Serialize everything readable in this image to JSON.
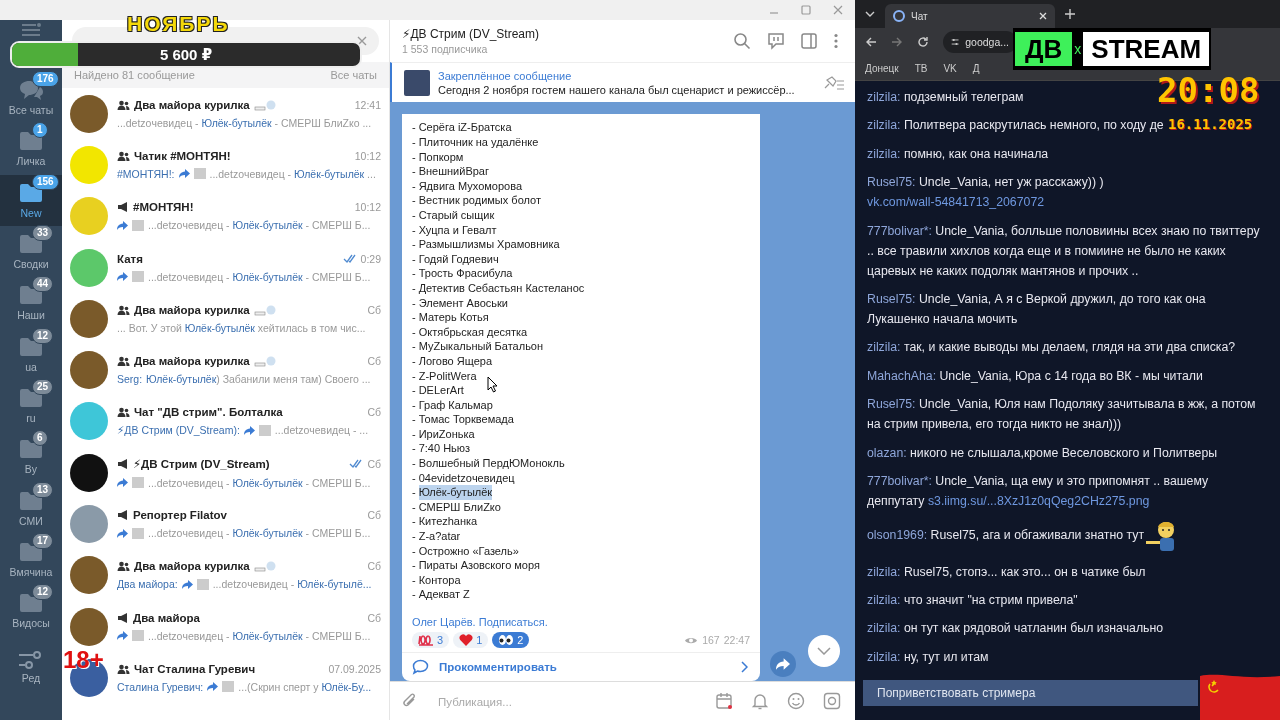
{
  "overlays": {
    "goal": {
      "title": "НОЯБРЬ",
      "amount": "5 600 ₽",
      "level": 0.19
    },
    "age_mark": "18+",
    "logo": {
      "left": "ДВ",
      "mid": "x",
      "right": "STREAM"
    },
    "clock": {
      "time": "20:08",
      "date": "16.11.2025"
    }
  },
  "folders": [
    {
      "kind": "all",
      "label": "Все чаты",
      "count": "176",
      "muted": false,
      "selected": false
    },
    {
      "kind": "folder",
      "label": "Личка",
      "count": "1",
      "muted": false,
      "selected": false
    },
    {
      "kind": "folder",
      "label": "New",
      "count": "156",
      "muted": false,
      "selected": true
    },
    {
      "kind": "folder",
      "label": "Сводки",
      "count": "33",
      "muted": true,
      "selected": false
    },
    {
      "kind": "folder",
      "label": "Наши",
      "count": "44",
      "muted": true,
      "selected": false
    },
    {
      "kind": "folder",
      "label": "ua",
      "count": "12",
      "muted": true,
      "selected": false
    },
    {
      "kind": "folder",
      "label": "ru",
      "count": "25",
      "muted": true,
      "selected": false
    },
    {
      "kind": "folder",
      "label": "By",
      "count": "6",
      "muted": true,
      "selected": false
    },
    {
      "kind": "folder",
      "label": "СМИ",
      "count": "13",
      "muted": true,
      "selected": false
    },
    {
      "kind": "folder",
      "label": "Вмячина",
      "count": "17",
      "muted": true,
      "selected": false
    },
    {
      "kind": "folder",
      "label": "Видосы",
      "count": "12",
      "muted": true,
      "selected": false
    },
    {
      "kind": "edit",
      "label": "Ред",
      "selected": false
    }
  ],
  "search": {
    "found": "Найдено 81 сообщение",
    "scope": "Все чаты"
  },
  "chats": [
    {
      "kind": "group",
      "title": "Два майора курилка",
      "emoji": true,
      "time": "12:41",
      "color": "#7a5a2a",
      "preview": [
        {
          "kind": "text",
          "before": "...detzoчевидец - ",
          "match": "Юлёк-бутылёк",
          "after": " - СМЕРШ БлиZко ..."
        }
      ]
    },
    {
      "kind": "group",
      "title": "Чатик #МОНТЯН!",
      "time": "10:12",
      "color": "#f2e600",
      "preview": [
        {
          "kind": "sender",
          "text": "#МОНТЯН!:"
        },
        {
          "kind": "fwd"
        },
        {
          "kind": "media"
        },
        {
          "kind": "text",
          "before": "...detzoчевидец - ",
          "match": "Юлёк-бутылёк",
          "after": " ..."
        }
      ]
    },
    {
      "kind": "channel",
      "title": "#МОНТЯН!",
      "time": "10:12",
      "color": "#e8d020",
      "preview": [
        {
          "kind": "fwd"
        },
        {
          "kind": "media"
        },
        {
          "kind": "text",
          "before": "...detzoчевидец - ",
          "match": "Юлёк-бутылёк",
          "after": " - СМЕРШ Б..."
        }
      ]
    },
    {
      "kind": "private",
      "title": "Катя",
      "time": "0:29",
      "read": true,
      "color": "#5cc86a",
      "preview": [
        {
          "kind": "fwd"
        },
        {
          "kind": "media"
        },
        {
          "kind": "text",
          "before": "...detzoчевидец - ",
          "match": "Юлёк-бутылёк",
          "after": " - СМЕРШ Б..."
        }
      ]
    },
    {
      "kind": "group",
      "title": "Два майора курилка",
      "emoji": true,
      "time": "Сб",
      "color": "#7a5a2a",
      "preview": [
        {
          "kind": "text",
          "before": "... Вот. У этой ",
          "match": "Юлёк-бутылёк",
          "after": " хейтилась в том чис..."
        }
      ]
    },
    {
      "kind": "group",
      "title": "Два майора курилка",
      "emoji": true,
      "time": "Сб",
      "color": "#7a5a2a",
      "preview": [
        {
          "kind": "sender",
          "text": "Serg:"
        },
        {
          "kind": "text",
          "match": "Юлёк-бутылёк",
          "after": ") Забанили меня там) Своего ..."
        }
      ]
    },
    {
      "kind": "group",
      "title": "Чат \"ДВ стрим\". Болталка",
      "time": "Сб",
      "color": "#3ec6d8",
      "preview": [
        {
          "kind": "sender",
          "text": "⚡ДВ Стрим (DV_Stream):"
        },
        {
          "kind": "fwd"
        },
        {
          "kind": "media"
        },
        {
          "kind": "text",
          "before": "...detzoчевидец - ..."
        }
      ]
    },
    {
      "kind": "channel",
      "title": "⚡ДВ Стрим (DV_Stream)",
      "time": "Сб",
      "read": true,
      "color": "#111111",
      "preview": [
        {
          "kind": "fwd"
        },
        {
          "kind": "media"
        },
        {
          "kind": "text",
          "before": "...detzoчевидец - ",
          "match": "Юлёк-бутылёк",
          "after": " - СМЕРШ Б..."
        }
      ]
    },
    {
      "kind": "channel",
      "title": "Репортер Filatov",
      "time": "Сб",
      "color": "#8a9aa8",
      "preview": [
        {
          "kind": "fwd"
        },
        {
          "kind": "media"
        },
        {
          "kind": "text",
          "before": "...detzoчевидец - ",
          "match": "Юлёк-бутылёк",
          "after": " - СМЕРШ Б..."
        }
      ]
    },
    {
      "kind": "group",
      "title": "Два майора курилка",
      "emoji": true,
      "time": "Сб",
      "color": "#7a5a2a",
      "preview": [
        {
          "kind": "sender",
          "text": "Два майора:"
        },
        {
          "kind": "fwd"
        },
        {
          "kind": "media"
        },
        {
          "kind": "text",
          "before": "...detzoчевидец - ",
          "match": "Юлёк-бутылё..."
        }
      ]
    },
    {
      "kind": "channel",
      "title": "Два майора",
      "time": "Сб",
      "color": "#7a5a2a",
      "preview": [
        {
          "kind": "fwd"
        },
        {
          "kind": "media"
        },
        {
          "kind": "text",
          "before": "...detzoчевидец - ",
          "match": "Юлёк-бутылёк",
          "after": " - СМЕРШ Б..."
        }
      ]
    },
    {
      "kind": "group",
      "title": "Чат Сталина Гуревич",
      "time": "07.09.2025",
      "color": "#3a5fa0",
      "preview": [
        {
          "kind": "sender",
          "text": "Сталина Гуревич:"
        },
        {
          "kind": "fwd"
        },
        {
          "kind": "media"
        },
        {
          "kind": "text",
          "before": "...(Скрин сперт у ",
          "match": "Юлёк-Бу..."
        }
      ]
    }
  ],
  "channel": {
    "title": "⚡ДВ Стрим (DV_Stream)",
    "subscribers": "1 553 подписчика"
  },
  "pinned": {
    "label": "Закреплённое сообщение",
    "text": "Сегодня 2 ноября гостем нашего канала был сценарист и режиссёр..."
  },
  "post": {
    "lines": [
      {
        "marker": "-",
        "text": "Серёга iZ-Братска",
        "selected": false
      },
      {
        "marker": "-",
        "text": "Плиточник на удалёнке",
        "selected": false
      },
      {
        "marker": "-",
        "text": "Попкорм",
        "selected": false
      },
      {
        "marker": "-",
        "text": "ВнешнийВраг",
        "selected": false
      },
      {
        "marker": "-",
        "text": "Ядвига Мухоморова",
        "selected": false
      },
      {
        "marker": "-",
        "text": "Вестник родимых болот",
        "selected": false
      },
      {
        "marker": "-",
        "text": "Старый сыщик",
        "selected": false
      },
      {
        "marker": "-",
        "text": "Хуцпа и Гевалт",
        "selected": false
      },
      {
        "marker": "-",
        "text": "Размышлизмы Храмовника",
        "selected": false
      },
      {
        "marker": "-",
        "text": "Годяй Годяевич",
        "selected": false
      },
      {
        "marker": "-",
        "text": "Трость Фрасибула",
        "selected": false
      },
      {
        "marker": "-",
        "text": "Детектив Себастьян Кастеланос",
        "selected": false
      },
      {
        "marker": "-",
        "text": "Элемент Авоськи",
        "selected": false
      },
      {
        "marker": "-",
        "text": "Матерь Котья",
        "selected": false
      },
      {
        "marker": "-",
        "text": "Октябрьская десятка",
        "selected": false
      },
      {
        "marker": "-",
        "text": "МуZыкальный Батальон",
        "selected": false
      },
      {
        "marker": "-",
        "text": "Логово Ящера",
        "selected": false
      },
      {
        "marker": "-",
        "text": "Z-PolitWera",
        "selected": false
      },
      {
        "marker": "-",
        "text": "DELerArt",
        "selected": false
      },
      {
        "marker": "-",
        "text": "Граф Кальмар",
        "selected": false
      },
      {
        "marker": "-",
        "text": "Томас Торквемада",
        "selected": false
      },
      {
        "marker": "-",
        "text": "ИриZонька",
        "selected": false
      },
      {
        "marker": "-",
        "text": "7:40 Ньюз",
        "selected": false
      },
      {
        "marker": "-",
        "text": "Волшебный ПердЮМонокль",
        "selected": false
      },
      {
        "marker": "-",
        "text": "04evidetzoчевидец",
        "selected": false
      },
      {
        "marker": "-",
        "text": "Юлёк-бутылёк",
        "selected": true
      },
      {
        "marker": "-",
        "text": "СМЕРШ БлиZко",
        "selected": false
      },
      {
        "marker": "-",
        "text": "Китеzhанка",
        "selected": false
      },
      {
        "marker": "-",
        "text": "Z-a?atar",
        "selected": false
      },
      {
        "marker": "-",
        "text": "Острожно «Газель»",
        "selected": false
      },
      {
        "marker": "-",
        "text": "Пираты Азовского моря",
        "selected": false
      },
      {
        "marker": "-",
        "text": "Контора",
        "selected": false
      },
      {
        "marker": "-",
        "text": "Адекват Z",
        "selected": false
      }
    ],
    "link": "Олег Царёв. Подписаться.",
    "reactions": [
      {
        "kind": "hundred",
        "count": "3",
        "selected": false
      },
      {
        "kind": "heart",
        "count": "1",
        "selected": false
      },
      {
        "kind": "eyes",
        "count": "2",
        "selected": true
      }
    ],
    "views": "167",
    "time": "22:47",
    "comment": "Прокомментировать"
  },
  "composer": {
    "placeholder": "Публикация..."
  },
  "browser": {
    "tab": "Чат",
    "address": "goodga...",
    "bookmarks": [
      "Донецк",
      "ТВ",
      "VK",
      "Д"
    ]
  },
  "stream_chat": [
    {
      "user": "zilzila:",
      "text": "подземный телеграм"
    },
    {
      "user": "zilzila:",
      "text": "Политвера раскрутилась немного, по ходу де"
    },
    {
      "user": "zilzila:",
      "text": "помню, как она начинала"
    },
    {
      "user": "Rusel75:",
      "text": "Uncle_Vania, нет уж расскажу)) ) ",
      "link": "vk.com/wall-54841713_2067072"
    },
    {
      "user": "777bolivar*:",
      "text": "Uncle_Vania, болльше половиины всех знаю по твиттеру .. все травили хихлов когда еще и в помиине не было не каких царевых не каких подоляк мантянов и прочих .."
    },
    {
      "user": "Rusel75:",
      "text": "Uncle_Vania, А я с Веркой дружил, до того как она Лукашенко начала мочить"
    },
    {
      "user": "zilzila:",
      "text": "так, и какие выводы мы делаем, глядя на эти два списка?"
    },
    {
      "user": "MahachAha:",
      "text": "Uncle_Vania, Юра с 14 года во ВК - мы читали"
    },
    {
      "user": "Rusel75:",
      "text": "Uncle_Vania, Юля нам Подоляку зачитывала в жж, а потом на стрим привела, его тогда никто не знал)))"
    },
    {
      "user": "olazan:",
      "text": "никого не слышала,кроме Веселовского и Политверы"
    },
    {
      "user": "777bolivar*:",
      "text": "Uncle_Vania, ща ему и это припомнят .. вашему деппутату ",
      "link": "s3.iimg.su/...8XzJ1z0qQeg2CHz275.png"
    },
    {
      "user": "olson1969:",
      "text": "Rusel75, ага и обгаживали знатно тут",
      "sticker": true
    },
    {
      "user": "zilzila:",
      "text": "Rusel75, стопэ... как это... он в чатике был"
    },
    {
      "user": "zilzila:",
      "text": "что значит \"на стрим привела\""
    },
    {
      "user": "zilzila:",
      "text": "он тут как рядовой чатланин был изначально"
    },
    {
      "user": "zilzila:",
      "text": "ну, тут ил итам"
    }
  ],
  "greet_button": "Поприветствовать стримера"
}
